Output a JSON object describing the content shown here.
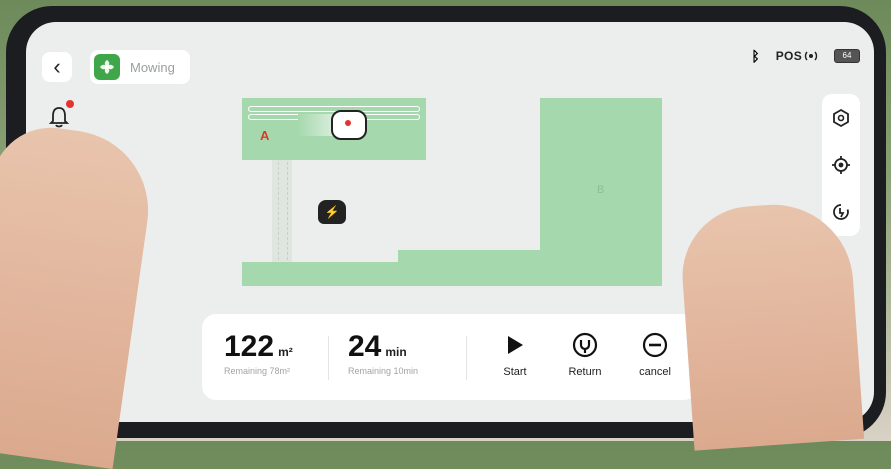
{
  "header": {
    "back_icon": "chevron-left-icon",
    "mode_label": "Mowing",
    "notification_icon": "bell-icon"
  },
  "status": {
    "bluetooth_icon": "bluetooth-icon",
    "pos_label": "POS",
    "battery_label": "64"
  },
  "map": {
    "zones": [
      {
        "label": "A",
        "color": "#d93a2b"
      },
      {
        "label": "B",
        "color": "#8cbf94"
      }
    ],
    "zone_color": "#a6d8ae"
  },
  "tools": [
    "hexagon-icon",
    "locate-target-icon",
    "charging-station-icon"
  ],
  "stats": {
    "area_value": "122",
    "area_unit": "m²",
    "area_sub": "Remaining 78m²",
    "time_value": "24",
    "time_unit": "min",
    "time_sub": "Remaining 10min"
  },
  "actions": {
    "start_label": "Start",
    "return_label": "Return",
    "cancel_label": "cancel"
  }
}
